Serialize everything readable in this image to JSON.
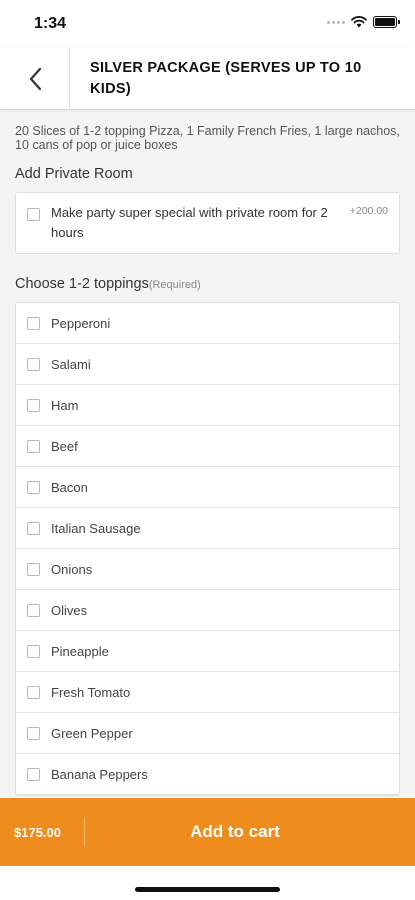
{
  "status_bar": {
    "time": "1:34"
  },
  "header": {
    "title": "SILVER PACKAGE (SERVES UP TO 10 KIDS)"
  },
  "description": "20 Slices of 1-2 topping Pizza, 1 Family French Fries, 1 large nachos, 10 cans of pop or juice boxes",
  "private_room": {
    "title": "Add Private Room",
    "option_label": "Make party super special with private room for 2 hours",
    "option_price": "+200.00"
  },
  "toppings": {
    "title": "Choose 1-2 toppings",
    "required_label": "(Required)",
    "items": [
      "Pepperoni",
      "Salami",
      "Ham",
      "Beef",
      "Bacon",
      "Italian Sausage",
      "Onions",
      "Olives",
      "Pineapple",
      "Fresh Tomato",
      "Green Pepper",
      "Banana Peppers"
    ]
  },
  "cart": {
    "price": "$175.00",
    "button_label": "Add to cart"
  },
  "colors": {
    "accent": "#ef8c1e"
  }
}
